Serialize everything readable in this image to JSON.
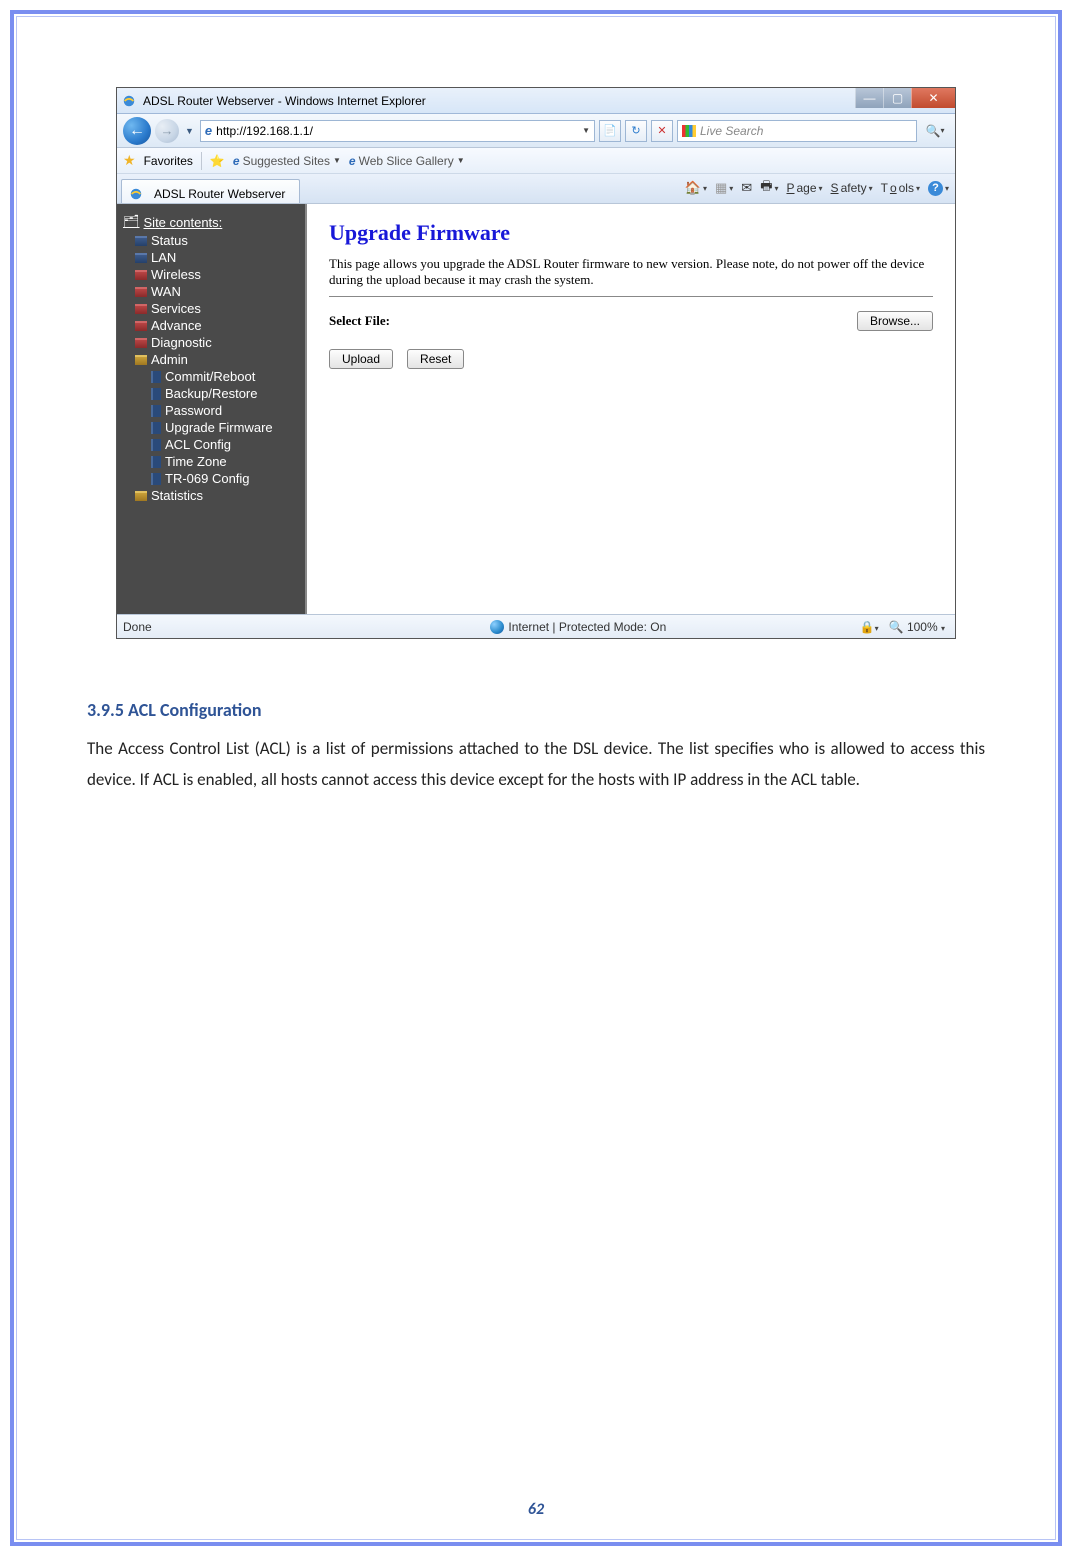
{
  "window": {
    "title": "ADSL Router Webserver - Windows Internet Explorer",
    "url": "http://192.168.1.1/",
    "search_placeholder": "Live Search"
  },
  "favorites": {
    "label": "Favorites",
    "suggested": "Suggested Sites",
    "gallery": "Web Slice Gallery"
  },
  "tab": {
    "title": "ADSL Router Webserver"
  },
  "command_bar": {
    "page": "Page",
    "safety": "Safety",
    "tools": "Tools"
  },
  "sidebar": {
    "heading": "Site contents:",
    "items": [
      "Status",
      "LAN",
      "Wireless",
      "WAN",
      "Services",
      "Advance",
      "Diagnostic",
      "Admin",
      "Statistics"
    ],
    "admin_children": [
      "Commit/Reboot",
      "Backup/Restore",
      "Password",
      "Upgrade Firmware",
      "ACL Config",
      "Time Zone",
      "TR-069 Config"
    ]
  },
  "main": {
    "title": "Upgrade Firmware",
    "desc": "This page allows you upgrade the ADSL Router firmware to new version. Please note, do not power off the device during the upload because it may crash the system.",
    "select_label": "Select File:",
    "browse": "Browse...",
    "upload": "Upload",
    "reset": "Reset"
  },
  "statusbar": {
    "done": "Done",
    "mode": "Internet | Protected Mode: On",
    "zoom": "100%"
  },
  "doc": {
    "heading": "3.9.5 ACL Configuration",
    "para": "The Access Control List (ACL) is a list of permissions attached to the DSL device. The list specifies who is allowed to access this device. If ACL is enabled, all hosts cannot access this device except for the hosts with IP address in the ACL table."
  },
  "page_number": "62"
}
